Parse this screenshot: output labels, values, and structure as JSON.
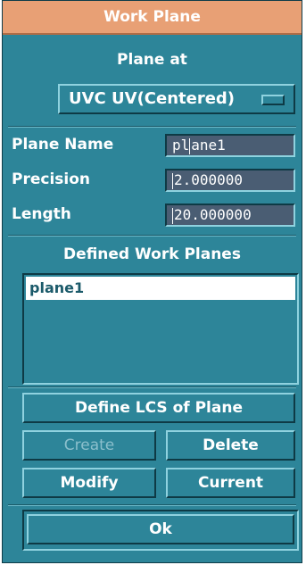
{
  "window": {
    "title": "Work Plane"
  },
  "plane_at": {
    "label": "Plane at",
    "selected_option": "UVC UV(Centered)"
  },
  "fields": {
    "plane_name": {
      "label": "Plane Name",
      "value_before_caret": "pl",
      "value_after_caret": "ane1"
    },
    "precision": {
      "label": "Precision",
      "value": "2.000000"
    },
    "length": {
      "label": "Length",
      "value": "20.000000"
    }
  },
  "defined_planes": {
    "label": "Defined Work Planes",
    "items": [
      "plane1"
    ]
  },
  "buttons": {
    "define_lcs": "Define LCS of Plane",
    "create": "Create",
    "delete": "Delete",
    "modify": "Modify",
    "current": "Current",
    "ok": "Ok"
  },
  "colors": {
    "panel": "#2d8599",
    "title_bar": "#e8a075",
    "field_bg": "#4a5d73",
    "selection_bg": "#ffffff"
  }
}
